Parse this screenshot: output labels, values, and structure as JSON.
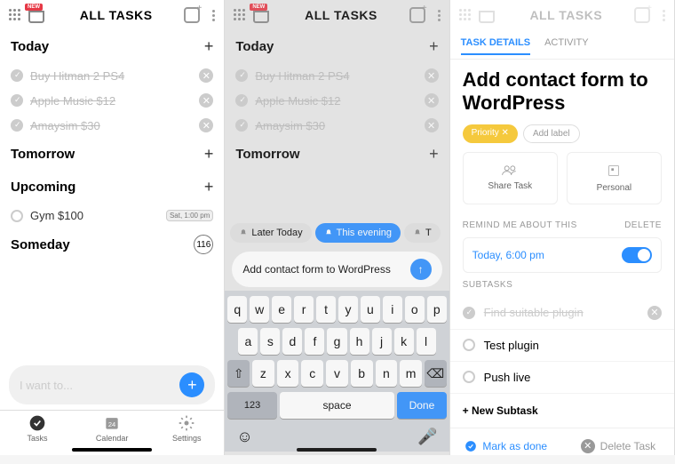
{
  "header": {
    "title": "ALL TASKS",
    "newBadge": "NEW"
  },
  "s1": {
    "sections": {
      "today": "Today",
      "tomorrow": "Tomorrow",
      "upcoming": "Upcoming",
      "someday": "Someday"
    },
    "todayTasks": [
      {
        "text": "Buy Hitman 2 PS4",
        "done": true
      },
      {
        "text": "Apple Music $12",
        "done": true
      },
      {
        "text": "Amaysim $30",
        "done": true
      }
    ],
    "upcomingTasks": [
      {
        "text": "Gym $100",
        "badge": "Sat, 1:00 pm"
      }
    ],
    "somedayCount": "116",
    "inputPlaceholder": "I want to...",
    "tabs": {
      "tasks": "Tasks",
      "calendar": "Calendar",
      "settings": "Settings"
    }
  },
  "s2": {
    "chips": {
      "later": "Later Today",
      "evening": "This evening",
      "tom": "Tomorrow"
    },
    "composeText": "Add contact form to WordPress",
    "keys": {
      "r1": [
        "q",
        "w",
        "e",
        "r",
        "t",
        "y",
        "u",
        "i",
        "o",
        "p"
      ],
      "r2": [
        "a",
        "s",
        "d",
        "f",
        "g",
        "h",
        "j",
        "k",
        "l"
      ],
      "r3": [
        "z",
        "x",
        "c",
        "v",
        "b",
        "n",
        "m"
      ],
      "num": "123",
      "space": "space",
      "done": "Done"
    }
  },
  "s3": {
    "tabs": {
      "details": "TASK DETAILS",
      "activity": "ACTIVITY"
    },
    "title": "Add contact form to WordPress",
    "priority": "Priority",
    "addLabel": "Add label",
    "share": "Share Task",
    "personal": "Personal",
    "remindHdr": "REMIND ME ABOUT THIS",
    "delete": "DELETE",
    "remindTime": "Today, 6:00 pm",
    "subtasksHdr": "SUBTASKS",
    "subtasks": [
      {
        "text": "Find suitable plugin",
        "done": true
      },
      {
        "text": "Test plugin",
        "done": false
      },
      {
        "text": "Push live",
        "done": false
      }
    ],
    "newSubtask": "+ New Subtask",
    "markDone": "Mark as done",
    "deleteTask": "Delete Task"
  }
}
